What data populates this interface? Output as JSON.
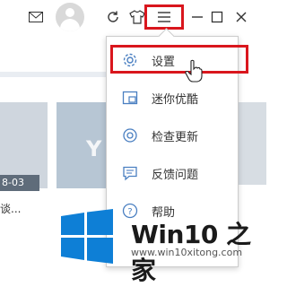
{
  "titlebar": {
    "icons": [
      "mail-icon",
      "avatar",
      "refresh-icon",
      "skin-icon",
      "menu-icon",
      "minimize-icon",
      "maximize-icon",
      "close-icon"
    ]
  },
  "background": {
    "date": "8-03",
    "caption": "谈..."
  },
  "dropdown": {
    "items": [
      {
        "label": "设置",
        "icon": "gear-icon"
      },
      {
        "label": "迷你优酷",
        "icon": "mini-player-icon"
      },
      {
        "label": "检查更新",
        "icon": "update-icon"
      },
      {
        "label": "反馈问题",
        "icon": "feedback-icon"
      },
      {
        "label": "帮助",
        "icon": "help-icon"
      }
    ]
  },
  "watermark": {
    "title": "Win10 之家",
    "url": "www.win10xitong.com"
  },
  "colors": {
    "highlight": "#d9161d",
    "icon_blue": "#4a7fc1",
    "win_blue": "#0e7fd6"
  }
}
